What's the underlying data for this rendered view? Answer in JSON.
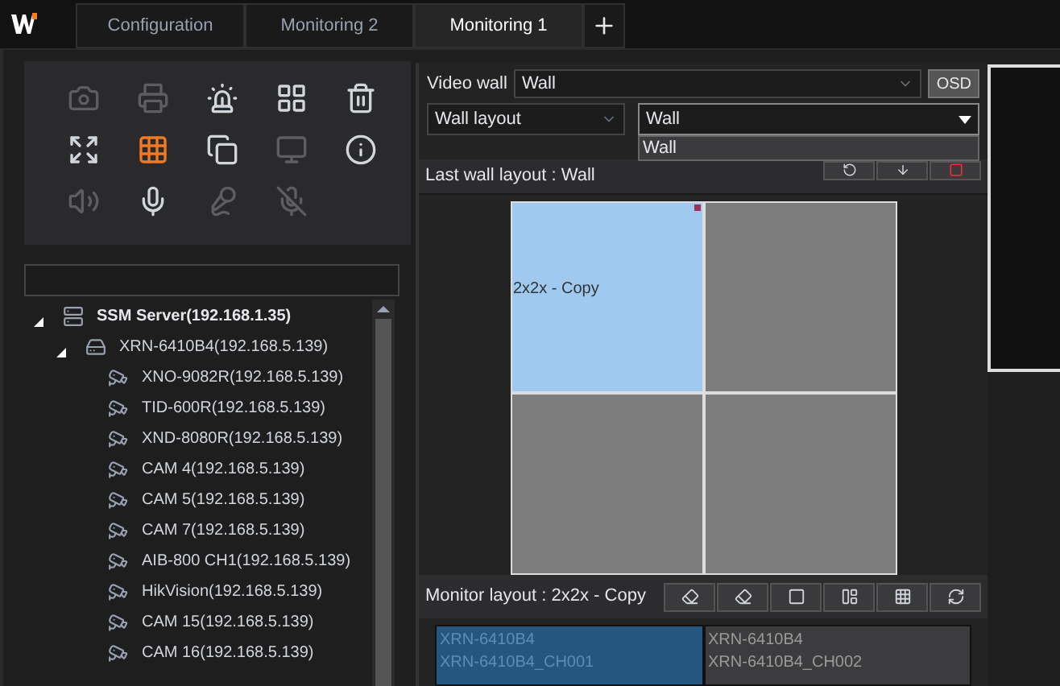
{
  "tabs": [
    {
      "label": "Configuration",
      "selected": false
    },
    {
      "label": "Monitoring 2",
      "selected": false
    },
    {
      "label": "Monitoring 1",
      "selected": true
    }
  ],
  "toolbar": [
    {
      "disabled": true,
      "selected": false
    },
    {
      "disabled": true,
      "selected": false
    },
    {
      "disabled": false,
      "selected": false
    },
    {
      "disabled": false,
      "selected": false
    },
    {
      "disabled": false,
      "selected": false
    },
    {
      "disabled": false,
      "selected": false
    },
    {
      "disabled": false,
      "selected": true
    },
    {
      "disabled": false,
      "selected": false
    },
    {
      "disabled": true,
      "selected": false
    },
    {
      "disabled": false,
      "selected": false
    },
    {
      "disabled": true,
      "selected": false
    },
    {
      "disabled": false,
      "selected": false
    },
    {
      "disabled": true,
      "selected": false
    },
    {
      "disabled": true,
      "selected": false
    }
  ],
  "tree": [
    {
      "label": "SSM Server(192.168.1.35)",
      "kind": "server",
      "expanded": true,
      "children": [
        {
          "label": "XRN-6410B4(192.168.5.139)",
          "kind": "recorder",
          "expanded": true,
          "children": [
            {
              "label": "XNO-9082R(192.168.5.139)",
              "kind": "camera"
            },
            {
              "label": "TID-600R(192.168.5.139)",
              "kind": "camera"
            },
            {
              "label": "XND-8080R(192.168.5.139)",
              "kind": "camera"
            },
            {
              "label": "CAM 4(192.168.5.139)",
              "kind": "camera"
            },
            {
              "label": "CAM 5(192.168.5.139)",
              "kind": "camera"
            },
            {
              "label": "CAM 7(192.168.5.139)",
              "kind": "camera"
            },
            {
              "label": "AIB-800 CH1(192.168.5.139)",
              "kind": "camera"
            },
            {
              "label": "HikVision(192.168.5.139)",
              "kind": "camera"
            },
            {
              "label": "CAM 15(192.168.5.139)",
              "kind": "camera"
            },
            {
              "label": "CAM 16(192.168.5.139)",
              "kind": "camera"
            }
          ]
        }
      ]
    }
  ],
  "video_wall": {
    "label": "Video wall",
    "value": "Wall",
    "osd": "OSD"
  },
  "wall_layout": {
    "value": "Wall layout",
    "layout": "Wall",
    "options": [
      {
        "label": "Wall",
        "selected": true
      }
    ]
  },
  "last_wall_layout": "Last wall layout : Wall",
  "wall_cells": [
    {
      "label": "2x2x - Copy",
      "selected": true
    },
    {
      "selected": false
    },
    {
      "selected": false
    },
    {
      "selected": false
    }
  ],
  "monitor_layout": "Monitor layout : 2x2x - Copy",
  "monitor_cells": [
    {
      "lines": [
        "XRN-6410B4",
        "XRN-6410B4_CH001"
      ],
      "selected": true
    },
    {
      "lines": [
        "XRN-6410B4",
        "XRN-6410B4_CH002"
      ],
      "selected": false
    }
  ]
}
